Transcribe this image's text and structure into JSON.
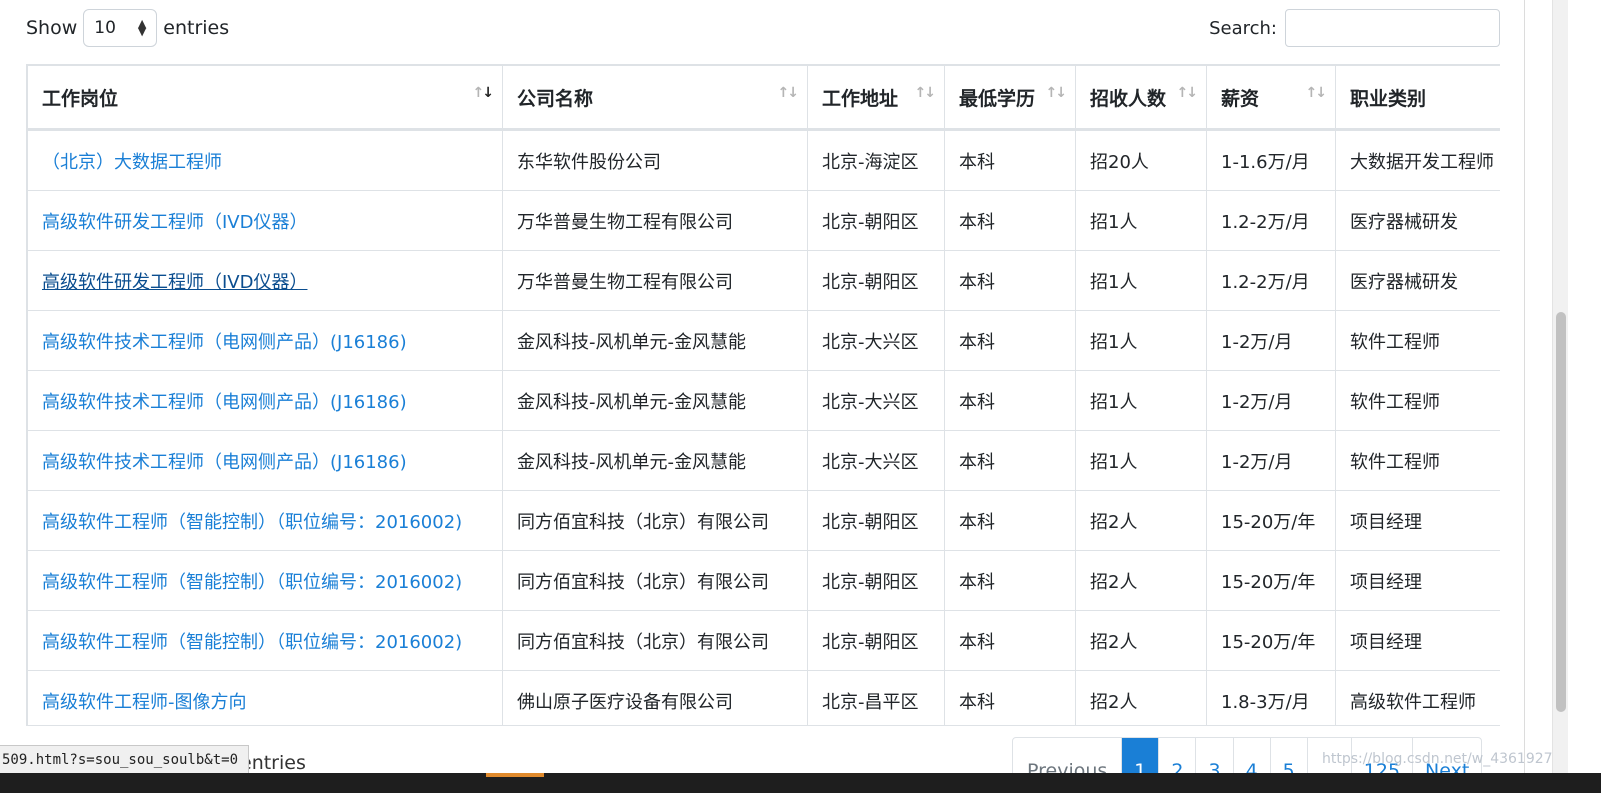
{
  "length_control": {
    "show_label": "Show",
    "value": "10",
    "entries_label": "entries"
  },
  "search": {
    "label": "Search:",
    "value": ""
  },
  "table": {
    "columns": [
      "工作岗位",
      "公司名称",
      "工作地址",
      "最低学历",
      "招收人数",
      "薪资",
      "职业类别"
    ],
    "rows": [
      {
        "job": "（北京）大数据工程师",
        "company": "东华软件股份公司",
        "location": "北京-海淀区",
        "education": "本科",
        "headcount": "招20人",
        "salary": "1-1.6万/月",
        "category": "大数据开发工程师"
      },
      {
        "job": "高级软件研发工程师（IVD仪器）",
        "company": "万华普曼生物工程有限公司",
        "location": "北京-朝阳区",
        "education": "本科",
        "headcount": "招1人",
        "salary": "1.2-2万/月",
        "category": "医疗器械研发"
      },
      {
        "job": "高级软件研发工程师（IVD仪器）",
        "company": "万华普曼生物工程有限公司",
        "location": "北京-朝阳区",
        "education": "本科",
        "headcount": "招1人",
        "salary": "1.2-2万/月",
        "category": "医疗器械研发"
      },
      {
        "job": "高级软件技术工程师（电网侧产品）(J16186)",
        "company": "金风科技-风机单元-金风慧能",
        "location": "北京-大兴区",
        "education": "本科",
        "headcount": "招1人",
        "salary": "1-2万/月",
        "category": "软件工程师"
      },
      {
        "job": "高级软件技术工程师（电网侧产品）(J16186)",
        "company": "金风科技-风机单元-金风慧能",
        "location": "北京-大兴区",
        "education": "本科",
        "headcount": "招1人",
        "salary": "1-2万/月",
        "category": "软件工程师"
      },
      {
        "job": "高级软件技术工程师（电网侧产品）(J16186)",
        "company": "金风科技-风机单元-金风慧能",
        "location": "北京-大兴区",
        "education": "本科",
        "headcount": "招1人",
        "salary": "1-2万/月",
        "category": "软件工程师"
      },
      {
        "job": "高级软件工程师（智能控制）（职位编号：2016002)",
        "company": "同方佰宜科技（北京）有限公司",
        "location": "北京-朝阳区",
        "education": "本科",
        "headcount": "招2人",
        "salary": "15-20万/年",
        "category": "项目经理"
      },
      {
        "job": "高级软件工程师（智能控制）（职位编号：2016002)",
        "company": "同方佰宜科技（北京）有限公司",
        "location": "北京-朝阳区",
        "education": "本科",
        "headcount": "招2人",
        "salary": "15-20万/年",
        "category": "项目经理"
      },
      {
        "job": "高级软件工程师（智能控制）（职位编号：2016002)",
        "company": "同方佰宜科技（北京）有限公司",
        "location": "北京-朝阳区",
        "education": "本科",
        "headcount": "招2人",
        "salary": "15-20万/年",
        "category": "项目经理"
      },
      {
        "job": "高级软件工程师-图像方向",
        "company": "佛山原子医疗设备有限公司",
        "location": "北京-昌平区",
        "education": "本科",
        "headcount": "招2人",
        "salary": "1.8-3万/月",
        "category": "高级软件工程师"
      }
    ]
  },
  "info": {
    "text": "entries"
  },
  "pagination": {
    "previous": "Previous",
    "pages": [
      "1",
      "2",
      "3",
      "4",
      "5"
    ],
    "ellipsis": "…",
    "last": "125",
    "next": "Next",
    "current": "1"
  },
  "status_bar": {
    "url": "509.html?s=sou_sou_soulb&t=0"
  },
  "watermark": {
    "text": "https://blog.csdn.net/w_43619271"
  },
  "colors": {
    "link": "#1a7fd6",
    "active_page": "#1a7fd6",
    "border": "#dee2e6"
  }
}
